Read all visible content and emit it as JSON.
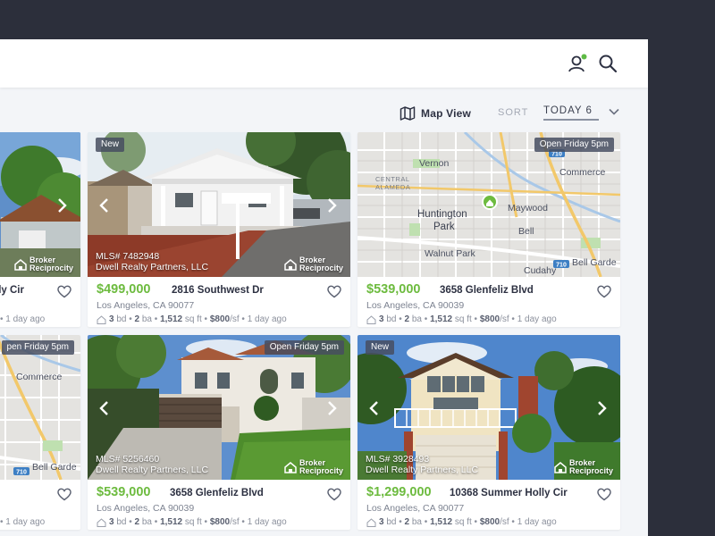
{
  "header": {
    "user_icon": "user-icon",
    "search_icon": "search-icon",
    "status_dot_color": "#5fbb46"
  },
  "toolbar": {
    "map_view_label": "Map View",
    "sort_label": "SORT",
    "sort_value": "TODAY 6"
  },
  "colors": {
    "price": "#6dbb3f",
    "background": "#f3f5f8",
    "frame": "#2c2f3b"
  },
  "listings": [
    {
      "city": "",
      "title_partial": "olly Cir",
      "stats_tail": "1 day ago"
    },
    {
      "badge": "New",
      "mls": "MLS# 7482948",
      "broker": "Dwell Realty Partners, LLC",
      "broker_logo": "Broker Reciprocity",
      "price": "$499,000",
      "address": "2816 Southwest Dr",
      "city": "Los Angeles, CA 90077",
      "beds": "3",
      "beds_unit": "bd",
      "baths": "2",
      "baths_unit": "ba",
      "sqft": "1,512",
      "sqft_unit": "sq ft",
      "ppsf": "$800",
      "ppsf_unit": "/sf",
      "age": "1 day ago"
    },
    {
      "badge": "Open Friday 5pm",
      "price": "$539,000",
      "address": "3658 Glenfeliz Blvd",
      "city": "Los Angeles, CA 90039",
      "beds": "3",
      "beds_unit": "bd",
      "baths": "2",
      "baths_unit": "ba",
      "sqft": "1,512",
      "sqft_unit": "sq ft",
      "ppsf": "$800",
      "ppsf_unit": "/sf",
      "age": "1 day ago",
      "map_labels": {
        "vernon": "Vernon",
        "commerce": "Commerce",
        "central": "CENTRAL",
        "alameda": "ALAMEDA",
        "huntington": "Huntington",
        "park": "Park",
        "maywood": "Maywood",
        "bell": "Bell",
        "walnut_park": "Walnut Park",
        "cudahy": "Cudahy",
        "bell_gardens": "Bell Garde",
        "hwy_710": "710"
      }
    },
    {
      "badge": "pen Friday 5pm",
      "map_labels": {
        "commerce": "Commerce",
        "bell_gardens": "Bell Garde",
        "hwy_710": "710"
      },
      "stats_tail": "1 day ago"
    },
    {
      "badge": "Open Friday 5pm",
      "mls": "MLS# 5256460",
      "broker": "Dwell Realty Partners, LLC",
      "broker_logo": "Broker Reciprocity",
      "price": "$539,000",
      "address": "3658 Glenfeliz Blvd",
      "city": "Los Angeles, CA 90039",
      "beds": "3",
      "beds_unit": "bd",
      "baths": "2",
      "baths_unit": "ba",
      "sqft": "1,512",
      "sqft_unit": "sq ft",
      "ppsf": "$800",
      "ppsf_unit": "/sf",
      "age": "1 day ago"
    },
    {
      "badge": "New",
      "mls": "MLS# 3928493",
      "broker": "Dwell Realty Partners, LLC",
      "broker_logo": "Broker Reciprocity",
      "price": "$1,299,000",
      "address": "10368 Summer Holly Cir",
      "city": "Los Angeles, CA 90077",
      "beds": "3",
      "beds_unit": "bd",
      "baths": "2",
      "baths_unit": "ba",
      "sqft": "1,512",
      "sqft_unit": "sq ft",
      "ppsf": "$800",
      "ppsf_unit": "/sf",
      "age": "1 day ago"
    }
  ],
  "broker_logo_lines": [
    "Broker",
    "Reciprocity"
  ]
}
